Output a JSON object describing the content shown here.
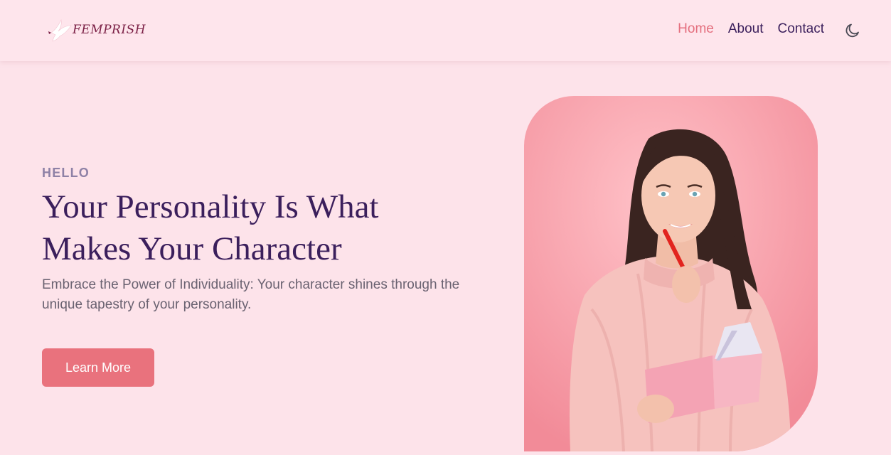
{
  "brand": {
    "name": "FEMPRISH"
  },
  "nav": {
    "items": [
      {
        "label": "Home",
        "active": true
      },
      {
        "label": "About",
        "active": false
      },
      {
        "label": "Contact",
        "active": false
      }
    ],
    "theme_icon": "moon-icon"
  },
  "hero": {
    "eyebrow": "HELLO",
    "title_line1": "Your Personality Is What",
    "title_line2": "Makes Your Character",
    "subtitle": "Embrace the Power of Individuality: Your character shines through the unique tapestry of your personality.",
    "cta_label": "Learn More",
    "image_icon": "woman-with-book-photo"
  },
  "colors": {
    "page_bg": "#fde3ea",
    "accent": "#e9727d",
    "heading": "#3b1f5c",
    "eyebrow": "#8e81a6",
    "body_text": "#6a6271"
  }
}
